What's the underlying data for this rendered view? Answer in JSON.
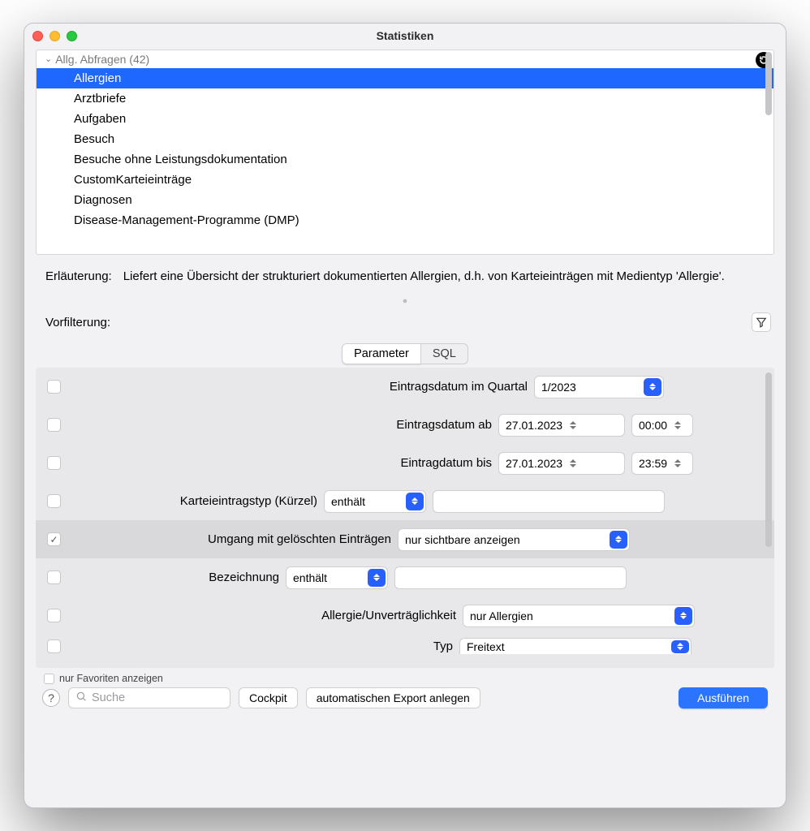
{
  "window": {
    "title": "Statistiken"
  },
  "tree": {
    "group_label": "Allg. Abfragen (42)",
    "items": [
      "Allergien",
      "Arztbriefe",
      "Aufgaben",
      "Besuch",
      "Besuche ohne Leistungsdokumentation",
      "CustomKarteieinträge",
      "Diagnosen",
      "Disease-Management-Programme (DMP)"
    ],
    "selected": "Allergien"
  },
  "explain": {
    "label": "Erläuterung:",
    "text": "Liefert eine Übersicht der strukturiert dokumentierten Allergien, d.h. von Karteieinträgen mit Medientyp 'Allergie'."
  },
  "prefilter_label": "Vorfilterung:",
  "tabs": {
    "parameter": "Parameter",
    "sql": "SQL"
  },
  "params": {
    "r1": {
      "label": "Eintragsdatum im Quartal",
      "value": "1/2023"
    },
    "r2": {
      "label": "Eintragsdatum ab",
      "date": "27.01.2023",
      "time": "00:00"
    },
    "r3": {
      "label": "Eintragdatum bis",
      "date": "27.01.2023",
      "time": "23:59"
    },
    "r4": {
      "label": "Karteieintragstyp (Kürzel)",
      "op": "enthält",
      "value": ""
    },
    "r5": {
      "label": "Umgang mit gelöschten Einträgen",
      "value": "nur sichtbare anzeigen"
    },
    "r6": {
      "label": "Bezeichnung",
      "op": "enthält",
      "value": ""
    },
    "r7": {
      "label": "Allergie/Unverträglichkeit",
      "value": "nur Allergien"
    },
    "r8": {
      "label": "Typ",
      "value": "Freitext"
    }
  },
  "bottom": {
    "favorites_only": "nur Favoriten anzeigen",
    "search_placeholder": "Suche",
    "cockpit": "Cockpit",
    "auto_export": "automatischen Export anlegen",
    "run": "Ausführen"
  }
}
